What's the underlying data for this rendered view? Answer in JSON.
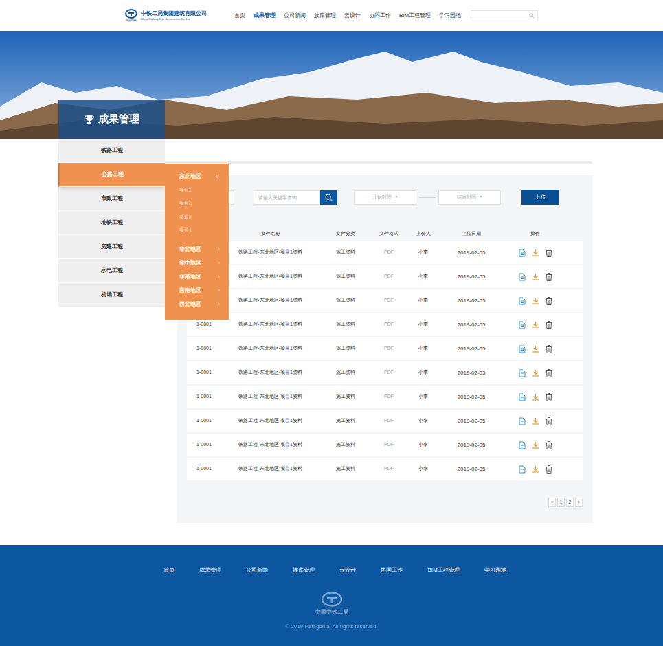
{
  "header": {
    "logo": {
      "mark": "中国中铁",
      "title": "中铁二局集团建筑有限公司",
      "subtitle": "China Railway Erju Construction Co.,Ltd"
    },
    "nav": [
      {
        "label": "首页",
        "selected": false
      },
      {
        "label": "成果管理",
        "selected": true
      },
      {
        "label": "公司新闻",
        "selected": false
      },
      {
        "label": "族库管理",
        "selected": false
      },
      {
        "label": "云设计",
        "selected": false
      },
      {
        "label": "协同工作",
        "selected": false
      },
      {
        "label": "BIM工程管理",
        "selected": false
      },
      {
        "label": "学习园地",
        "selected": false
      }
    ]
  },
  "banner": {
    "title": "成果管理"
  },
  "sidebar": {
    "items": [
      {
        "label": "铁路工程",
        "selected": false
      },
      {
        "label": "公路工程",
        "selected": true
      },
      {
        "label": "市政工程",
        "selected": false
      },
      {
        "label": "地铁工程",
        "selected": false
      },
      {
        "label": "房建工程",
        "selected": false
      },
      {
        "label": "水电工程",
        "selected": false
      },
      {
        "label": "机场工程",
        "selected": false
      }
    ]
  },
  "flyout": {
    "regions": [
      {
        "label": "东北地区",
        "arrow": "∨",
        "expanded": true,
        "projects": [
          "项目1",
          "项目2",
          "项目3",
          "项目4"
        ]
      },
      {
        "label": "华北地区",
        "arrow": "›",
        "expanded": false,
        "projects": []
      },
      {
        "label": "华中地区",
        "arrow": "›",
        "expanded": false,
        "projects": []
      },
      {
        "label": "华南地区",
        "arrow": "›",
        "expanded": false,
        "projects": []
      },
      {
        "label": "西南地区",
        "arrow": "›",
        "expanded": false,
        "projects": []
      },
      {
        "label": "西北地区",
        "arrow": "›",
        "expanded": false,
        "projects": []
      }
    ]
  },
  "toolbar": {
    "search": {
      "placeholder": "请输入关键字查询"
    },
    "start_date": {
      "placeholder": "开始时间",
      "arrow": "▼"
    },
    "end_date": {
      "placeholder": "结束时间",
      "arrow": "▼"
    },
    "upload": "上 传"
  },
  "table": {
    "columns": [
      "",
      "文件名称",
      "文件分类",
      "文件格式",
      "上传人",
      "上传日期",
      "操作"
    ],
    "rows": [
      [
        "",
        "铁路工程-东北地区-项目1资料",
        "施工资料",
        "PDF",
        "小李",
        "2019-02-05"
      ],
      [
        "",
        "铁路工程-东北地区-项目1资料",
        "施工资料",
        "PDF",
        "小李",
        "2019-02-05"
      ],
      [
        "",
        "铁路工程-东北地区-项目1资料",
        "施工资料",
        "PDF",
        "小李",
        "2019-02-05"
      ],
      [
        "1-0001",
        "铁路工程-东北地区-项目1资料",
        "施工资料",
        "PDF",
        "小李",
        "2019-02-05"
      ],
      [
        "1-0001",
        "铁路工程-东北地区-项目1资料",
        "施工资料",
        "PDF",
        "小李",
        "2019-02-05"
      ],
      [
        "1-0001",
        "铁路工程-东北地区-项目1资料",
        "施工资料",
        "PDF",
        "小李",
        "2019-02-05"
      ],
      [
        "1-0001",
        "铁路工程-东北地区-项目1资料",
        "施工资料",
        "PDF",
        "小李",
        "2019-02-05"
      ],
      [
        "1-0001",
        "铁路工程-东北地区-项目1资料",
        "施工资料",
        "PDF",
        "小李",
        "2019-02-05"
      ],
      [
        "1-0001",
        "铁路工程-东北地区-项目1资料",
        "施工资料",
        "PDF",
        "小李",
        "2019-02-05"
      ],
      [
        "1-0001",
        "铁路工程-东北地区-项目1资料",
        "施工资料",
        "PDF",
        "小李",
        "2019-02-05"
      ]
    ]
  },
  "pagination": {
    "prev": "‹",
    "pages": [
      {
        "label": "1",
        "selected": true
      },
      {
        "label": "2",
        "selected": false
      }
    ],
    "next": "›"
  },
  "footer": {
    "nav": [
      "首页",
      "成果管理",
      "公司新闻",
      "族库管理",
      "云设计",
      "协同工作",
      "BIM工程管理",
      "学习园地"
    ],
    "logo_text": "中国中铁二局",
    "copyright": "© 2019 Patagonia. All rights reserved."
  }
}
